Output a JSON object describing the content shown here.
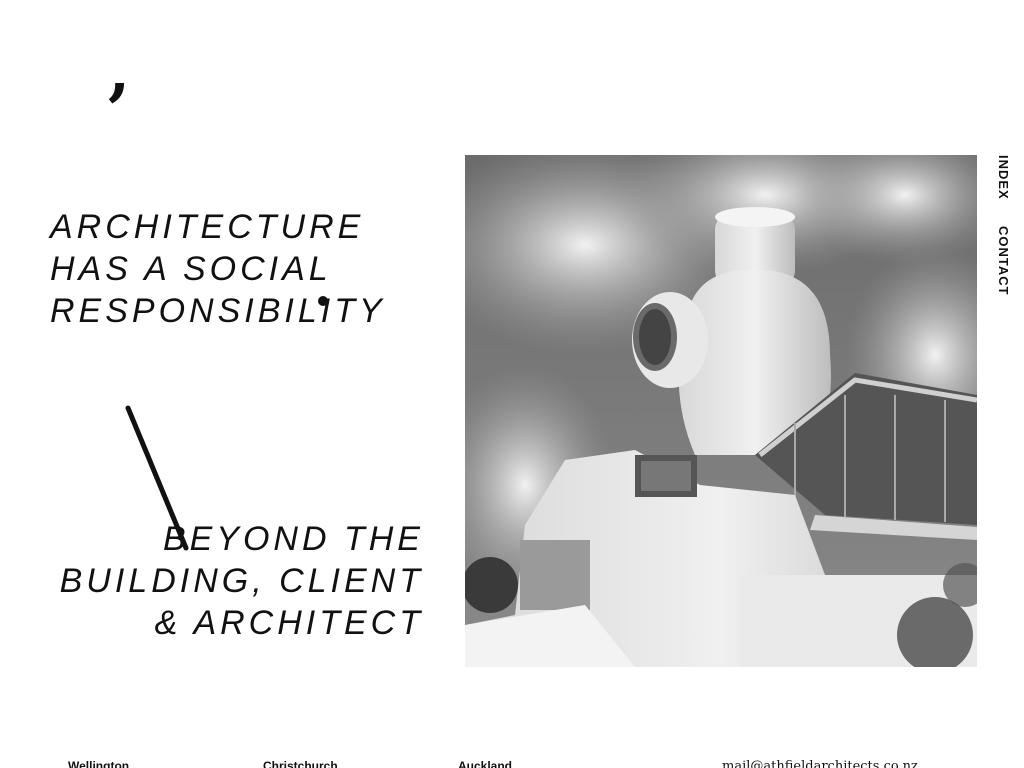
{
  "brand": {
    "mark": ","
  },
  "headline": {
    "line1": "ARCHITECTURE",
    "line2": "HAS A SOCIAL",
    "line3": "RESPONSIBILITY"
  },
  "subline": {
    "line1": "BEYOND THE",
    "line2": "BUILDING, CLIENT",
    "line3": "& ARCHITECT"
  },
  "nav": {
    "index": "INDEX",
    "contact": "CONTACT"
  },
  "hero": {
    "icon": "building-photo-icon"
  },
  "footer": {
    "wellington": "Wellington",
    "christchurch": "Christchurch",
    "auckland": "Auckland",
    "email": "mail@athfieldarchitects.co.nz"
  }
}
